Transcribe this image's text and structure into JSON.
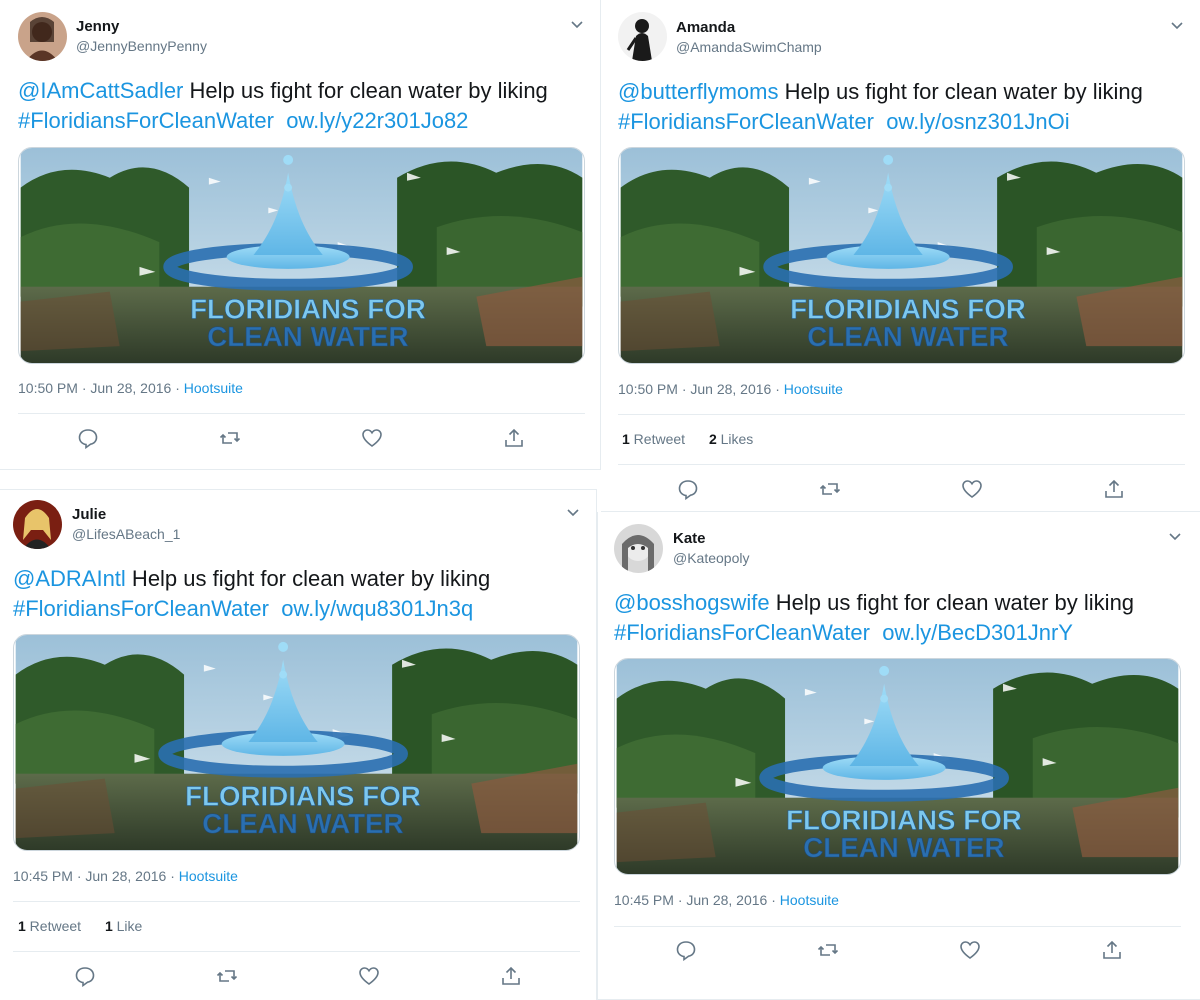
{
  "tweets": [
    {
      "name": "Jenny",
      "handle": "@JennyBennyPenny",
      "mention": "@IAmCattSadler",
      "body": " Help us fight for clean water by liking",
      "hashtag": "#FloridiansForCleanWater",
      "link": "ow.ly/y22r301Jo82",
      "time": "10:50 PM · Jun 28, 2016 · ",
      "source": "Hootsuite",
      "retweets_count": "",
      "retweets_label": "",
      "likes_count": "",
      "likes_label": "",
      "media_title_line1": "FLORIDIANS FOR",
      "media_title_line2": "CLEAN WATER"
    },
    {
      "name": "Amanda",
      "handle": "@AmandaSwimChamp",
      "mention": "@butterflymoms",
      "body": " Help us fight for clean water by liking",
      "hashtag": "#FloridiansForCleanWater",
      "link": "ow.ly/osnz301JnOi",
      "time": "10:50 PM · Jun 28, 2016 · ",
      "source": "Hootsuite",
      "retweets_count": "1",
      "retweets_label": " Retweet",
      "likes_count": "2",
      "likes_label": " Likes",
      "media_title_line1": "FLORIDIANS FOR",
      "media_title_line2": "CLEAN WATER"
    },
    {
      "name": "Julie",
      "handle": "@LifesABeach_1",
      "mention": "@ADRAIntl",
      "body": " Help us fight for clean water by liking",
      "hashtag": "#FloridiansForCleanWater",
      "link": "ow.ly/wqu8301Jn3q",
      "time": "10:45 PM · Jun 28, 2016 · ",
      "source": "Hootsuite",
      "retweets_count": "1",
      "retweets_label": " Retweet",
      "likes_count": "1",
      "likes_label": " Like",
      "media_title_line1": "FLORIDIANS FOR",
      "media_title_line2": "CLEAN WATER"
    },
    {
      "name": "Kate",
      "handle": "@Kateopoly",
      "mention": "@bosshogswife",
      "body": " Help us fight for clean water by liking",
      "hashtag": "#FloridiansForCleanWater",
      "link": "ow.ly/BecD301JnrY",
      "time": "10:45 PM · Jun 28, 2016 · ",
      "source": "Hootsuite",
      "retweets_count": "",
      "retweets_label": "",
      "likes_count": "",
      "likes_label": "",
      "media_title_line1": "FLORIDIANS FOR",
      "media_title_line2": "CLEAN WATER"
    }
  ],
  "icons": {
    "reply": "reply-icon",
    "retweet": "retweet-icon",
    "like": "heart-icon",
    "share": "share-icon",
    "caret": "chevron-down-icon"
  },
  "colors": {
    "link": "#1b95e0",
    "secondary_text": "#657786",
    "divider": "#e6ecf0",
    "logo_light": "#7dc8ee",
    "logo_dark": "#2a6fb0"
  }
}
